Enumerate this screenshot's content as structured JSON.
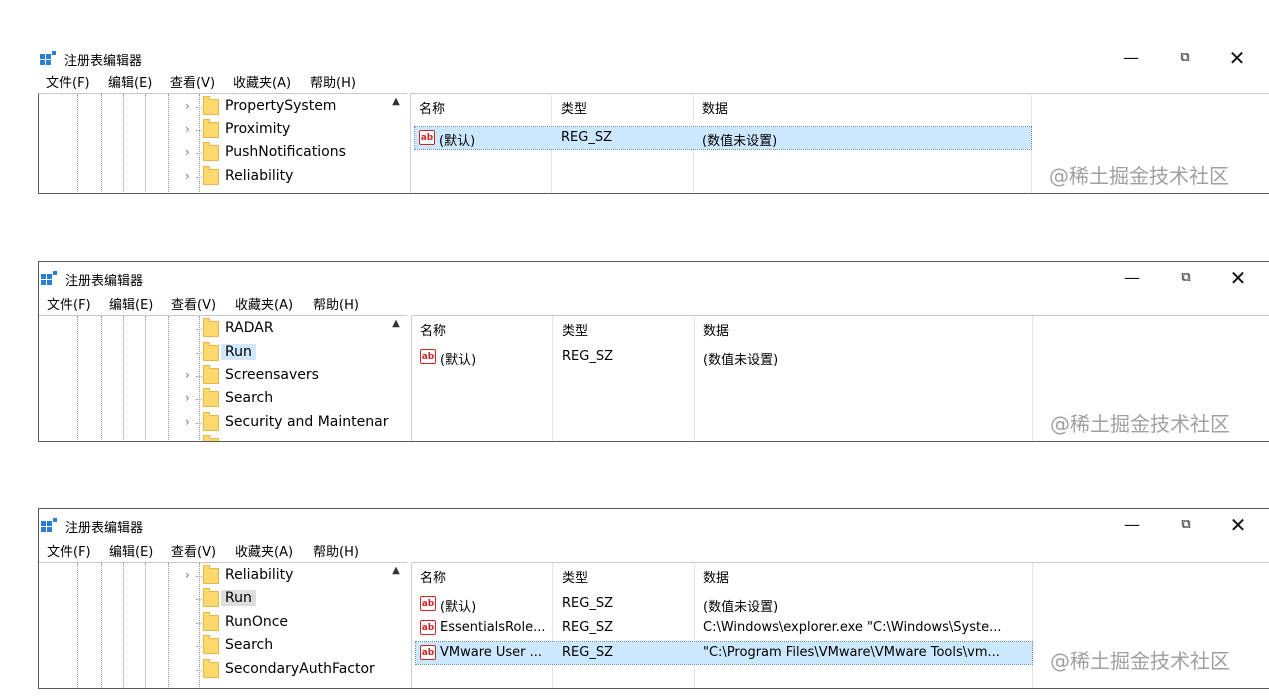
{
  "windows": [
    {
      "title": "注册表编辑器",
      "menu": [
        "文件(F)",
        "编辑(E)",
        "查看(V)",
        "收藏夹(A)",
        "帮助(H)"
      ],
      "tree": [
        {
          "label": "PropertySystem",
          "expandable": true
        },
        {
          "label": "Proximity",
          "expandable": true
        },
        {
          "label": "PushNotifications",
          "expandable": true
        },
        {
          "label": "Reliability",
          "expandable": true
        }
      ],
      "columns": {
        "name": "名称",
        "type": "类型",
        "data": "数据"
      },
      "rows": [
        {
          "name": "(默认)",
          "type": "REG_SZ",
          "data": "(数值未设置)",
          "selected": true
        }
      ],
      "watermark": "@稀土掘金技术社区"
    },
    {
      "title": "注册表编辑器",
      "menu": [
        "文件(F)",
        "编辑(E)",
        "查看(V)",
        "收藏夹(A)",
        "帮助(H)"
      ],
      "tree": [
        {
          "label": "RADAR",
          "expandable": false
        },
        {
          "label": "Run",
          "expandable": false,
          "selected": true
        },
        {
          "label": "Screensavers",
          "expandable": true
        },
        {
          "label": "Search",
          "expandable": true
        },
        {
          "label": "Security and Maintenar",
          "expandable": true
        }
      ],
      "columns": {
        "name": "名称",
        "type": "类型",
        "data": "数据"
      },
      "rows": [
        {
          "name": "(默认)",
          "type": "REG_SZ",
          "data": "(数值未设置)",
          "selected": false
        }
      ],
      "watermark": "@稀土掘金技术社区"
    },
    {
      "title": "注册表编辑器",
      "menu": [
        "文件(F)",
        "编辑(E)",
        "查看(V)",
        "收藏夹(A)",
        "帮助(H)"
      ],
      "tree": [
        {
          "label": "Reliability",
          "expandable": true
        },
        {
          "label": "Run",
          "expandable": false,
          "selected": true
        },
        {
          "label": "RunOnce",
          "expandable": false
        },
        {
          "label": "Search",
          "expandable": false
        },
        {
          "label": "SecondaryAuthFactor",
          "expandable": false
        }
      ],
      "columns": {
        "name": "名称",
        "type": "类型",
        "data": "数据"
      },
      "rows": [
        {
          "name": "(默认)",
          "type": "REG_SZ",
          "data": "(数值未设置)",
          "selected": false
        },
        {
          "name": "EssentialsRole...",
          "type": "REG_SZ",
          "data": "C:\\Windows\\explorer.exe \"C:\\Windows\\Syste...",
          "selected": false
        },
        {
          "name": "VMware User ...",
          "type": "REG_SZ",
          "data": "\"C:\\Program Files\\VMware\\VMware Tools\\vm...",
          "selected": true
        }
      ],
      "watermark": "@稀土掘金技术社区"
    }
  ],
  "icons": {
    "value_icon_text": "ab",
    "chevron": "›",
    "minimize": "—",
    "maximize": "⧉",
    "close": "✕"
  },
  "colors": {
    "selection": "#cce8ff",
    "folder": "#ffd96b",
    "string_icon": "#c62828"
  }
}
